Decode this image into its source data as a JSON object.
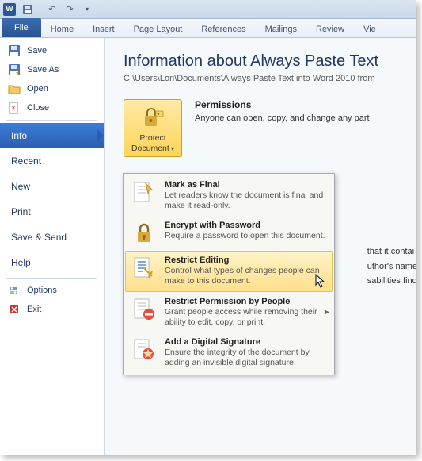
{
  "qat": {
    "save": "save",
    "undo": "undo",
    "redo": "redo"
  },
  "ribbon": {
    "file": "File",
    "tabs": [
      "Home",
      "Insert",
      "Page Layout",
      "References",
      "Mailings",
      "Review",
      "Vie"
    ]
  },
  "sidebar": {
    "commands_top": [
      {
        "icon": "save",
        "label": "Save"
      },
      {
        "icon": "saveas",
        "label": "Save As"
      },
      {
        "icon": "open",
        "label": "Open"
      },
      {
        "icon": "close",
        "label": "Close"
      }
    ],
    "nav": [
      {
        "label": "Info",
        "selected": true
      },
      {
        "label": "Recent",
        "selected": false
      },
      {
        "label": "New",
        "selected": false
      },
      {
        "label": "Print",
        "selected": false
      },
      {
        "label": "Save & Send",
        "selected": false
      },
      {
        "label": "Help",
        "selected": false
      }
    ],
    "commands_bottom": [
      {
        "icon": "options",
        "label": "Options"
      },
      {
        "icon": "exit",
        "label": "Exit"
      }
    ]
  },
  "content": {
    "title": "Information about Always Paste Text",
    "path": "C:\\Users\\Lori\\Documents\\Always Paste Text into Word 2010 from",
    "protect_label": "Protect Document",
    "permissions": {
      "heading": "Permissions",
      "body": "Anyone can open, copy, and change any part"
    },
    "bg_lines": [
      "that it contai",
      "uthor's name",
      "sabilities find"
    ]
  },
  "dropdown": {
    "items": [
      {
        "icon": "final",
        "title": "Mark as Final",
        "desc": "Let readers know the document is final and make it read-only."
      },
      {
        "icon": "encrypt",
        "title": "Encrypt with Password",
        "desc": "Require a password to open this document."
      },
      {
        "icon": "restrict",
        "title": "Restrict Editing",
        "desc": "Control what types of changes people can make to this document.",
        "hover": true
      },
      {
        "icon": "people",
        "title": "Restrict Permission by People",
        "desc": "Grant people access while removing their ability to edit, copy, or print.",
        "submenu": true
      },
      {
        "icon": "signature",
        "title": "Add a Digital Signature",
        "desc": "Ensure the integrity of the document by adding an invisible digital signature."
      }
    ]
  }
}
